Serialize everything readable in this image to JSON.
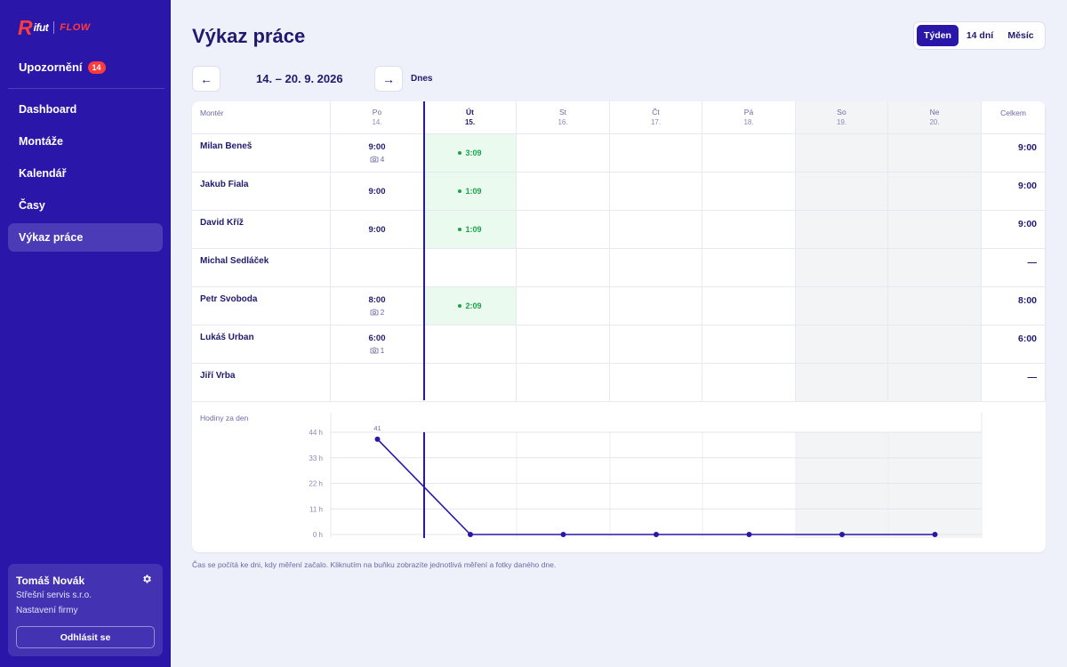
{
  "brand": {
    "logo_r": "R",
    "logo_word": "ifut",
    "logo_flow": "FLOW",
    "brand_color": "#ff3b3b"
  },
  "sidebar": {
    "notifications_label": "Upozornění",
    "notifications_count": "14",
    "items": [
      {
        "label": "Dashboard",
        "active": false
      },
      {
        "label": "Montáže",
        "active": false
      },
      {
        "label": "Kalendář",
        "active": false
      },
      {
        "label": "Časy",
        "active": false
      },
      {
        "label": "Výkaz práce",
        "active": true
      }
    ],
    "user": {
      "name": "Tomáš Novák",
      "company": "Střešní servis s.r.o.",
      "settings_label": "Nastavení firmy",
      "logout_label": "Odhlásit se"
    }
  },
  "page": {
    "title": "Výkaz práce",
    "range_tabs": [
      {
        "label": "Týden",
        "active": true
      },
      {
        "label": "14 dní",
        "active": false
      },
      {
        "label": "Měsíc",
        "active": false
      }
    ],
    "prev_label": "←",
    "next_label": "→",
    "date_range": "14. – 20. 9. 2026",
    "today_label": "Dnes",
    "footnote": "Čas se počítá ke dni, kdy měření začalo. Kliknutím na buňku zobrazíte jednotlivá měření a fotky daného dne."
  },
  "table": {
    "monter_header": "Montér",
    "total_header": "Celkem",
    "days": [
      {
        "name": "Po",
        "date": "14.",
        "today": false,
        "weekend": false
      },
      {
        "name": "Út",
        "date": "15.",
        "today": true,
        "weekend": false
      },
      {
        "name": "St",
        "date": "16.",
        "today": false,
        "weekend": false
      },
      {
        "name": "Čt",
        "date": "17.",
        "today": false,
        "weekend": false
      },
      {
        "name": "Pá",
        "date": "18.",
        "today": false,
        "weekend": false
      },
      {
        "name": "So",
        "date": "19.",
        "today": false,
        "weekend": true
      },
      {
        "name": "Ne",
        "date": "20.",
        "today": false,
        "weekend": true
      }
    ],
    "rows": [
      {
        "name": "Milan Beneš",
        "cells": [
          {
            "value": "9:00",
            "photos": "4"
          },
          {
            "live": "3:09"
          },
          {},
          {},
          {},
          {},
          {}
        ],
        "total": "9:00"
      },
      {
        "name": "Jakub Fiala",
        "cells": [
          {
            "value": "9:00"
          },
          {
            "live": "1:09"
          },
          {},
          {},
          {},
          {},
          {}
        ],
        "total": "9:00"
      },
      {
        "name": "David Kříž",
        "cells": [
          {
            "value": "9:00"
          },
          {
            "live": "1:09"
          },
          {},
          {},
          {},
          {},
          {}
        ],
        "total": "9:00"
      },
      {
        "name": "Michal Sedláček",
        "cells": [
          {},
          {},
          {},
          {},
          {},
          {},
          {}
        ],
        "total": "—"
      },
      {
        "name": "Petr Svoboda",
        "cells": [
          {
            "value": "8:00",
            "photos": "2"
          },
          {
            "live": "2:09"
          },
          {},
          {},
          {},
          {},
          {}
        ],
        "total": "8:00"
      },
      {
        "name": "Lukáš Urban",
        "cells": [
          {
            "value": "6:00",
            "photos": "1"
          },
          {},
          {},
          {},
          {},
          {},
          {}
        ],
        "total": "6:00"
      },
      {
        "name": "Jiří Vrba",
        "cells": [
          {},
          {},
          {},
          {},
          {},
          {},
          {}
        ],
        "total": "—"
      }
    ]
  },
  "chart_data": {
    "type": "line",
    "title": "Hodiny za den",
    "categories": [
      "Po",
      "Út",
      "St",
      "Čt",
      "Pá",
      "So",
      "Ne"
    ],
    "values": [
      41,
      0,
      0,
      0,
      0,
      0,
      0
    ],
    "point_labels": [
      "41",
      "",
      "",
      "",
      "",
      "",
      ""
    ],
    "yticks": [
      "44 h",
      "33 h",
      "22 h",
      "11 h",
      "0 h"
    ],
    "ylim": [
      0,
      44
    ],
    "line_color": "#2a16a8",
    "grid": true
  }
}
